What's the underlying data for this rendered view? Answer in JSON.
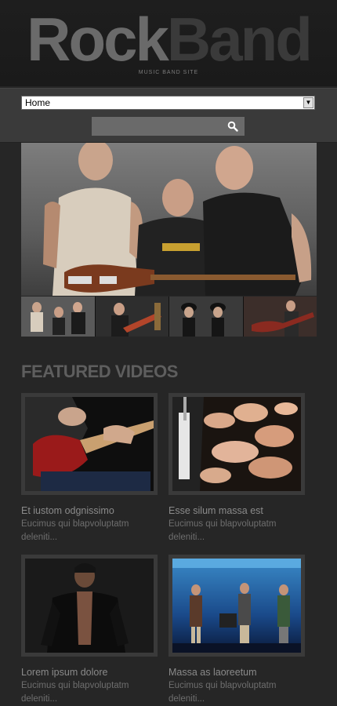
{
  "header": {
    "logo_part1": "Rock",
    "logo_part2": "Band",
    "tagline": "MUSIC BAND SITE"
  },
  "nav": {
    "selected": "Home",
    "search_placeholder": ""
  },
  "section": {
    "title": "FEATURED VIDEOS"
  },
  "videos": [
    {
      "title": "Et iustom odgnissimo",
      "desc": "Eucimus qui blapvoluptatm deleniti..."
    },
    {
      "title": "Esse silum massa est",
      "desc": "Eucimus qui blapvoluptatm deleniti..."
    },
    {
      "title": "Lorem ipsum dolore",
      "desc": "Eucimus qui blapvoluptatm deleniti..."
    },
    {
      "title": "Massa as laoreetum",
      "desc": "Eucimus qui blapvoluptatm deleniti..."
    }
  ]
}
